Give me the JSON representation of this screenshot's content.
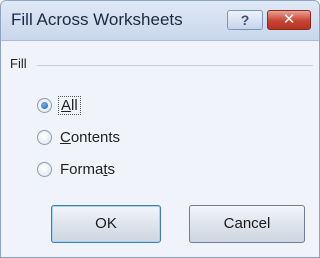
{
  "window": {
    "title": "Fill Across Worksheets",
    "help_label": "?",
    "close_label": "✕"
  },
  "fill_group": {
    "label": "Fill",
    "options": [
      {
        "before": "",
        "accel": "A",
        "after": "ll",
        "checked": true
      },
      {
        "before": "",
        "accel": "C",
        "after": "ontents",
        "checked": false
      },
      {
        "before": "Forma",
        "accel": "t",
        "after": "s",
        "checked": false
      }
    ]
  },
  "buttons": {
    "ok_label": "OK",
    "cancel_label": "Cancel"
  },
  "colors": {
    "titlebar": "#c9d7ec",
    "dialog_bg": "#f0f3f9",
    "close_button": "#c74432",
    "radio_dot": "#1f5fa8"
  }
}
